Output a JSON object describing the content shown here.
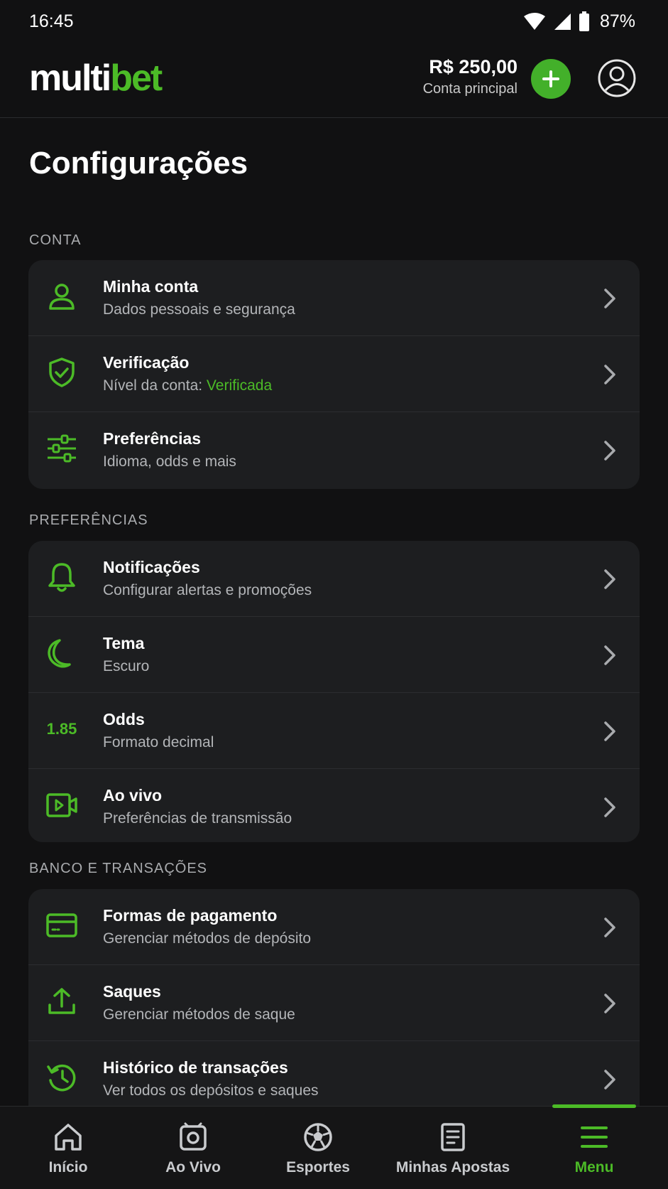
{
  "status_bar": {
    "time": "16:45",
    "battery": "87%"
  },
  "header": {
    "logo_part1": "multi",
    "logo_part2": "bet",
    "balance": "R$ 250,00",
    "account_label": "Conta principal"
  },
  "page_title": "Configurações",
  "sections": {
    "conta": {
      "label": "CONTA",
      "items": [
        {
          "title": "Minha conta",
          "subtitle": "Dados pessoais e segurança",
          "icon": "user-icon"
        },
        {
          "title": "Verificação",
          "subtitle": "Nível da conta: ",
          "status": "Verificada",
          "icon": "shield-check-icon"
        },
        {
          "title": "Preferências",
          "subtitle": "Idioma, odds e mais",
          "icon": "sliders-icon"
        }
      ]
    },
    "preferencias": {
      "label": "PREFERÊNCIAS",
      "items": [
        {
          "title": "Notificações",
          "subtitle": "Configurar alertas e promoções",
          "icon": "bell-icon"
        },
        {
          "title": "Tema",
          "subtitle": "Escuro",
          "icon": "moon-icon"
        },
        {
          "title": "Odds",
          "subtitle": "Formato decimal",
          "icon_text": "1.85"
        },
        {
          "title": "Ao vivo",
          "subtitle": "Preferências de transmissão",
          "icon": "live-video-icon"
        }
      ]
    },
    "banco": {
      "label": "BANCO E TRANSAÇÕES",
      "items": [
        {
          "title": "Formas de pagamento",
          "subtitle": "Gerenciar métodos de depósito",
          "icon": "credit-card-icon"
        },
        {
          "title": "Saques",
          "subtitle": "Gerenciar métodos de saque",
          "icon": "upload-icon"
        },
        {
          "title": "Histórico de transações",
          "subtitle": "Ver todos os depósitos e saques",
          "icon": "history-icon"
        }
      ]
    }
  },
  "bottom_nav": {
    "items": [
      {
        "label": "Início",
        "icon": "home-icon"
      },
      {
        "label": "Ao Vivo",
        "icon": "live-icon"
      },
      {
        "label": "Esportes",
        "icon": "soccer-ball-icon"
      },
      {
        "label": "Minhas Apostas",
        "icon": "bet-slip-icon"
      },
      {
        "label": "Menu",
        "icon": "menu-icon"
      }
    ],
    "active": "Menu"
  },
  "colors": {
    "accent": "#4cbb27",
    "background": "#111112",
    "card": "#1d1e20"
  }
}
